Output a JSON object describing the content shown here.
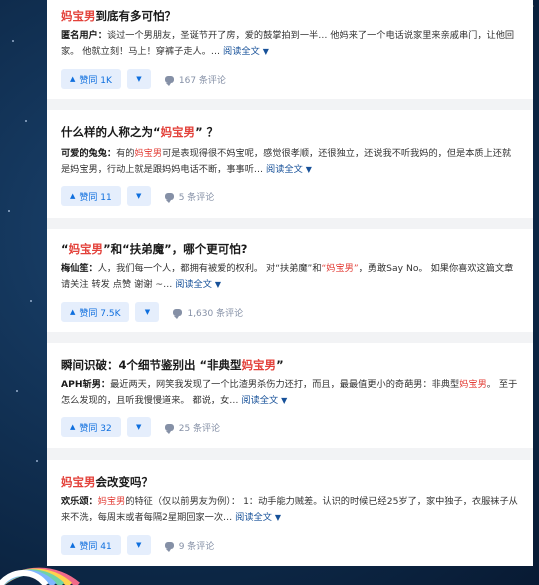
{
  "cards": [
    {
      "title_pre": "",
      "title_hl": "妈宝男",
      "title_post": "到底有多可怕？",
      "author": "匿名用户：",
      "excerpt": "谈过一个男朋友，圣诞节开了房，爱的鼓掌拍到一半… 他妈来了一个电话说家里来亲戚串门，让他回家。 他就立刻！马上！穿裤子走人。… ",
      "read_more": "阅读全文",
      "vote_count": "赞同 1K",
      "comments": "167 条评论"
    },
    {
      "title_pre": "什么样的人称之为“",
      "title_hl": "妈宝男",
      "title_post": "” ？",
      "author": "可爱的兔兔：",
      "excerpt_pre": "有的",
      "excerpt_hl": "妈宝男",
      "excerpt": "可是表现得很不妈宝呢，感觉很孝顺，还很独立，还说我不听我妈的，但是本质上还就是妈宝男，行动上就是跟妈妈电话不断，事事听… ",
      "read_more": "阅读全文",
      "vote_count": "赞同 11",
      "comments": "5 条评论"
    },
    {
      "title_pre": "“",
      "title_hl": "妈宝男",
      "title_post": "”和“扶弟魔”，哪个更可怕?",
      "author": "梅仙笙：",
      "excerpt": "人，我们每一个人，都拥有被爱的权利。 对“扶弟魔”和",
      "excerpt_hl": "“妈宝男”",
      "excerpt_post": "，勇敢Say No。 如果你喜欢这篇文章 请关注 转发 点赞 谢谢 ~… ",
      "read_more": "阅读全文",
      "vote_count": "赞同 7.5K",
      "comments": "1,630 条评论"
    },
    {
      "title_pre": "瞬间识破：4个细节鉴别出 “非典型",
      "title_hl": "妈宝男",
      "title_post": "”",
      "author": "APH斩男：",
      "excerpt": "最近两天，网笑我发现了一个比渣男杀伤力还打，而且，最最值更小的奇葩男：非典型",
      "excerpt_hl": "妈宝男",
      "excerpt_post": "。 至于怎么发现的，且听我慢慢道来。 都说，女… ",
      "read_more": "阅读全文",
      "vote_count": "赞同 32",
      "comments": "25 条评论"
    },
    {
      "title_pre": "",
      "title_hl": "妈宝男",
      "title_post": "会改变吗？",
      "author": "欢乐颂：",
      "excerpt_hl": "妈宝男",
      "excerpt": "的特征（仅以前男友为例）： 1：动手能力贼差。认识的时候已经25岁了，家中独子，衣服袜子从来不洗，每周末或者每隔2星期回家一次… ",
      "read_more": "阅读全文",
      "vote_count": "赞同 41",
      "comments": "9 条评论"
    }
  ],
  "colors": {
    "accent": "#0f6fde",
    "highlight": "#e3413a",
    "link": "#175199"
  }
}
